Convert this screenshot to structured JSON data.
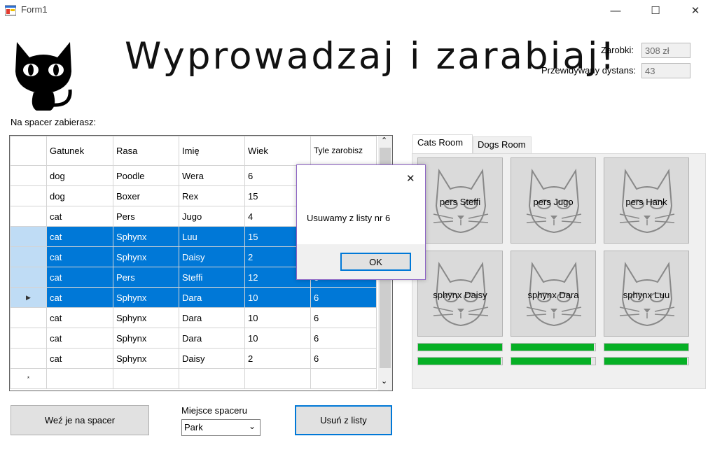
{
  "window": {
    "title": "Form1",
    "minimize_glyph": "—",
    "maximize_glyph": "☐",
    "close_glyph": "✕"
  },
  "header": {
    "heading": "Wyprowadzaj i zarabiaj!",
    "logo_icon": "black-cat-icon"
  },
  "stats": {
    "earnings_label": "Zarobki:",
    "earnings_value": "308 zł",
    "distance_label": "Przewidywany dystans:",
    "distance_value": "43"
  },
  "grid": {
    "caption": "Na spacer zabierasz:",
    "columns": [
      "Gatunek",
      "Rasa",
      "Imię",
      "Wiek",
      "Tyle zarobisz"
    ],
    "rows": [
      {
        "cells": [
          "dog",
          "Poodle",
          "Wera",
          "6",
          ""
        ],
        "selected": false
      },
      {
        "cells": [
          "dog",
          "Boxer",
          "Rex",
          "15",
          ""
        ],
        "selected": false
      },
      {
        "cells": [
          "cat",
          "Pers",
          "Jugo",
          "4",
          ""
        ],
        "selected": false
      },
      {
        "cells": [
          "cat",
          "Sphynx",
          "Luu",
          "15",
          ""
        ],
        "selected": true
      },
      {
        "cells": [
          "cat",
          "Sphynx",
          "Daisy",
          "2",
          ""
        ],
        "selected": true
      },
      {
        "cells": [
          "cat",
          "Pers",
          "Steffi",
          "12",
          "6"
        ],
        "selected": true
      },
      {
        "cells": [
          "cat",
          "Sphynx",
          "Dara",
          "10",
          "6"
        ],
        "selected": true,
        "current": true
      },
      {
        "cells": [
          "cat",
          "Sphynx",
          "Dara",
          "10",
          "6"
        ],
        "selected": false
      },
      {
        "cells": [
          "cat",
          "Sphynx",
          "Dara",
          "10",
          "6"
        ],
        "selected": false
      },
      {
        "cells": [
          "cat",
          "Sphynx",
          "Daisy",
          "2",
          "6"
        ],
        "selected": false
      }
    ],
    "current_row_marker": "▶",
    "new_row_marker": "*",
    "scroll_up": "⌃",
    "scroll_down": "⌄"
  },
  "controls": {
    "walk_button": "Weź je na spacer",
    "place_label": "Miejsce spaceru",
    "place_value": "Park",
    "remove_button": "Usuń z listy"
  },
  "tabs": [
    {
      "label": "Cats Room",
      "active": true
    },
    {
      "label": "Dogs Room",
      "active": false
    }
  ],
  "cats": [
    {
      "label": "pers Steffi"
    },
    {
      "label": "pers Jugo"
    },
    {
      "label": "pers Hank"
    },
    {
      "label": "sphynx Daisy"
    },
    {
      "label": "sphynx Dara"
    },
    {
      "label": "sphynx Luu"
    }
  ],
  "progress": [
    [
      1.0,
      0.98,
      1.0
    ],
    [
      0.98,
      0.95,
      0.98
    ]
  ],
  "dialog": {
    "message": "Usuwamy z listy nr 6",
    "ok_label": "OK",
    "close_glyph": "✕"
  },
  "colors": {
    "selection": "#0078d7",
    "progress_fill": "#06b025",
    "accent_border": "#0078d7"
  }
}
